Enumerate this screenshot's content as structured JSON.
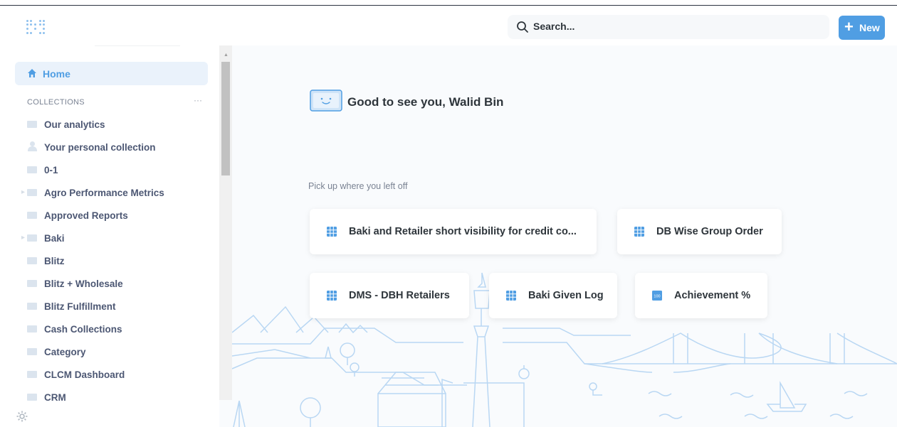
{
  "topbar": {
    "logo_icon": "metabase-logo-icon",
    "search": {
      "placeholder": "Search..."
    },
    "new_button": {
      "label": "New",
      "icon": "plus-icon"
    }
  },
  "sidebar": {
    "home_label": "Home",
    "collections_title": "COLLECTIONS",
    "collections_more": "···",
    "collections": [
      {
        "name": "Our analytics",
        "icon": "folder-icon",
        "expandable": false
      },
      {
        "name": "Your personal collection",
        "icon": "person-icon",
        "expandable": false
      },
      {
        "name": "0-1",
        "icon": "folder-icon",
        "expandable": false
      },
      {
        "name": "Agro Performance Metrics",
        "icon": "folder-icon",
        "expandable": true
      },
      {
        "name": "Approved Reports",
        "icon": "folder-icon",
        "expandable": false
      },
      {
        "name": "Baki",
        "icon": "folder-icon",
        "expandable": true
      },
      {
        "name": "Blitz",
        "icon": "folder-icon",
        "expandable": false
      },
      {
        "name": "Blitz + Wholesale",
        "icon": "folder-icon",
        "expandable": false
      },
      {
        "name": "Blitz Fulfillment",
        "icon": "folder-icon",
        "expandable": false
      },
      {
        "name": "Cash Collections",
        "icon": "folder-icon",
        "expandable": false
      },
      {
        "name": "Category",
        "icon": "folder-icon",
        "expandable": false
      },
      {
        "name": "CLCM Dashboard",
        "icon": "folder-icon",
        "expandable": false
      },
      {
        "name": "CRM",
        "icon": "folder-icon",
        "expandable": false
      }
    ],
    "settings_icon": "gear-icon"
  },
  "main": {
    "greeting": "Good to see you, Walid Bin",
    "pickup_heading": "Pick up where you left off",
    "recent_items": [
      {
        "label": "Baki and Retailer short visibility for credit co...",
        "icon": "table-icon"
      },
      {
        "label": "DB Wise Group Order",
        "icon": "table-icon"
      },
      {
        "label": "DMS - DBH Retailers",
        "icon": "table-icon"
      },
      {
        "label": "Baki Given Log",
        "icon": "table-icon"
      },
      {
        "label": "Achievement %",
        "icon": "number-icon"
      }
    ]
  },
  "colors": {
    "brand": "#509ee3",
    "text_dark": "#2e353b",
    "text_muted": "#7a8393",
    "home_highlight": "#eaf2fb",
    "illustration": "#b9d7f3"
  }
}
